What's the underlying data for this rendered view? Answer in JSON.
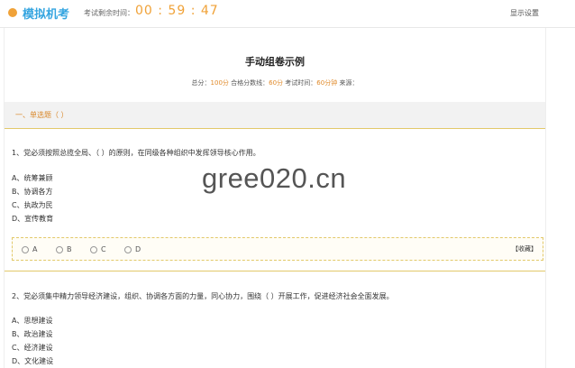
{
  "header": {
    "app_title": "模拟机考",
    "timer_label": "考试剩余时间：",
    "timer_value": "00 : 59 : 47",
    "settings_label": "显示设置"
  },
  "exam": {
    "title": "手动组卷示例",
    "info": {
      "total_label": "总分：",
      "total_value": "100分",
      "pass_label": " 合格分数线：",
      "pass_value": "60分",
      "time_label": " 考试时间：",
      "time_value": "60分钟",
      "source_label": " 来源："
    }
  },
  "section": {
    "title": "一、单选题（ ）"
  },
  "questions": [
    {
      "text": "1、党必须按照总揽全局、（ ）的原则，在同级各种组织中发挥领导核心作用。",
      "options": [
        "A、统筹兼顾",
        "B、协调各方",
        "C、执政为民",
        "D、宣传教育"
      ],
      "answer_choices": [
        "A",
        "B",
        "C",
        "D"
      ],
      "collect_label": "【收藏】"
    },
    {
      "text": "2、党必须集中精力领导经济建设，组织、协调各方面的力量，同心协力，围绕（ ）开展工作，促进经济社会全面发展。",
      "options": [
        "A、思想建设",
        "B、政治建设",
        "C、经济建设",
        "D、文化建设"
      ]
    }
  ],
  "watermark": "gree020.cn",
  "colors": {
    "accent_orange": "#f0a238",
    "logo_blue": "#35a5e0",
    "section_bg": "#f2f2f2",
    "gold_border": "#e2c96a"
  }
}
